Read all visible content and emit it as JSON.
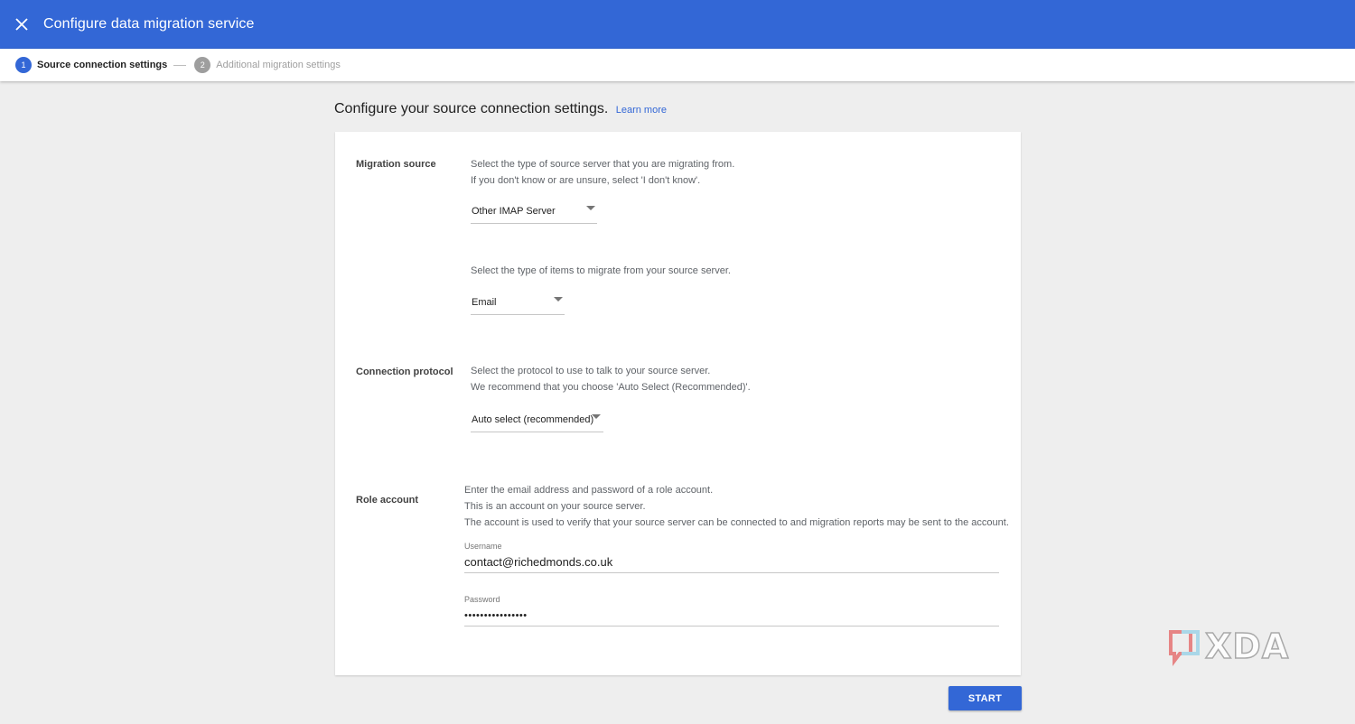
{
  "header": {
    "title": "Configure data migration service",
    "close_icon": "close-icon"
  },
  "stepper": {
    "steps": [
      {
        "number": "1",
        "label": "Source connection settings"
      },
      {
        "number": "2",
        "label": "Additional migration settings"
      }
    ]
  },
  "main": {
    "heading": "Configure your source connection settings.",
    "learn_more": "Learn more"
  },
  "migration_source": {
    "label": "Migration source",
    "desc_line1": "Select the type of source server that you are migrating from.",
    "desc_line2": "If you don't know or are unsure, select 'I don't know'.",
    "selected": "Other IMAP Server",
    "items_desc": "Select the type of items to migrate from your source server.",
    "items_selected": "Email"
  },
  "connection_protocol": {
    "label": "Connection protocol",
    "desc_line1": "Select the protocol to use to talk to your source server.",
    "desc_line2": "We recommend that you choose 'Auto Select (Recommended)'.",
    "selected": "Auto select (recommended)"
  },
  "role_account": {
    "label": "Role account",
    "desc_line1": "Enter the email address and password of a role account.",
    "desc_line2": "This is an account on your source server.",
    "desc_line3": "The account is used to verify that your source server can be connected to and migration reports may be sent to the account.",
    "username_label": "Username",
    "username_value": "contact@richedmonds.co.uk",
    "password_label": "Password",
    "password_value": "••••••••••••••••"
  },
  "footer": {
    "start_label": "START"
  },
  "watermark": {
    "text": "XDA"
  },
  "colors": {
    "accent": "#3367d6",
    "background": "#eeeeee",
    "card": "#ffffff"
  }
}
